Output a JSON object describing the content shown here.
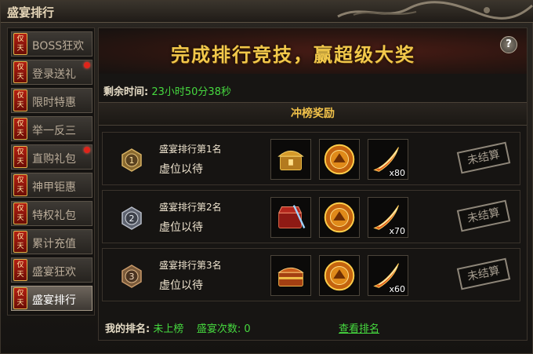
{
  "window": {
    "title": "盛宴排行"
  },
  "sidebar": {
    "items": [
      {
        "badge": "仅天",
        "label": "BOSS狂欢",
        "dot": false,
        "active": false
      },
      {
        "badge": "仅天",
        "label": "登录送礼",
        "dot": true,
        "active": false
      },
      {
        "badge": "仅天",
        "label": "限时特惠",
        "dot": false,
        "active": false
      },
      {
        "badge": "仅天",
        "label": "举一反三",
        "dot": false,
        "active": false
      },
      {
        "badge": "仅天",
        "label": "直购礼包",
        "dot": true,
        "active": false
      },
      {
        "badge": "仅天",
        "label": "神甲钜惠",
        "dot": false,
        "active": false
      },
      {
        "badge": "仅天",
        "label": "特权礼包",
        "dot": false,
        "active": false
      },
      {
        "badge": "仅天",
        "label": "累计充值",
        "dot": false,
        "active": false
      },
      {
        "badge": "仅天",
        "label": "盛宴狂欢",
        "dot": false,
        "active": false
      },
      {
        "badge": "仅天",
        "label": "盛宴排行",
        "dot": false,
        "active": true
      }
    ]
  },
  "banner": {
    "slogan": "完成排行竞技，赢超级大奖",
    "help": "?"
  },
  "timer": {
    "label": "剩余时间:",
    "value": "23小时50分38秒"
  },
  "section": {
    "title": "冲榜奖励"
  },
  "ranks": [
    {
      "medal": "1",
      "title": "盛宴排行第1名",
      "name": "虚位以待",
      "status": "未结算",
      "rewards": [
        {
          "icon": "golden-chest-icon",
          "count": ""
        },
        {
          "icon": "golden-medallion-icon",
          "count": ""
        },
        {
          "icon": "fire-feather-icon",
          "count": "x80"
        }
      ]
    },
    {
      "medal": "2",
      "title": "盛宴排行第2名",
      "name": "虚位以待",
      "status": "未结算",
      "rewards": [
        {
          "icon": "red-chest-icon",
          "count": ""
        },
        {
          "icon": "golden-medallion-icon",
          "count": ""
        },
        {
          "icon": "fire-feather-icon",
          "count": "x70"
        }
      ]
    },
    {
      "medal": "3",
      "title": "盛宴排行第3名",
      "name": "虚位以待",
      "status": "未结算",
      "rewards": [
        {
          "icon": "treasure-chest-icon",
          "count": ""
        },
        {
          "icon": "golden-medallion-icon",
          "count": ""
        },
        {
          "icon": "fire-feather-icon",
          "count": "x60"
        }
      ]
    }
  ],
  "footer": {
    "rank_label": "我的排名:",
    "rank_value": "未上榜",
    "count_label": "盛宴次数:",
    "count_value": "0",
    "link": "查看排名"
  },
  "colors": {
    "accent_gold": "#f2c24a",
    "value_green": "#46d93f",
    "badge_red": "#b31f12"
  }
}
